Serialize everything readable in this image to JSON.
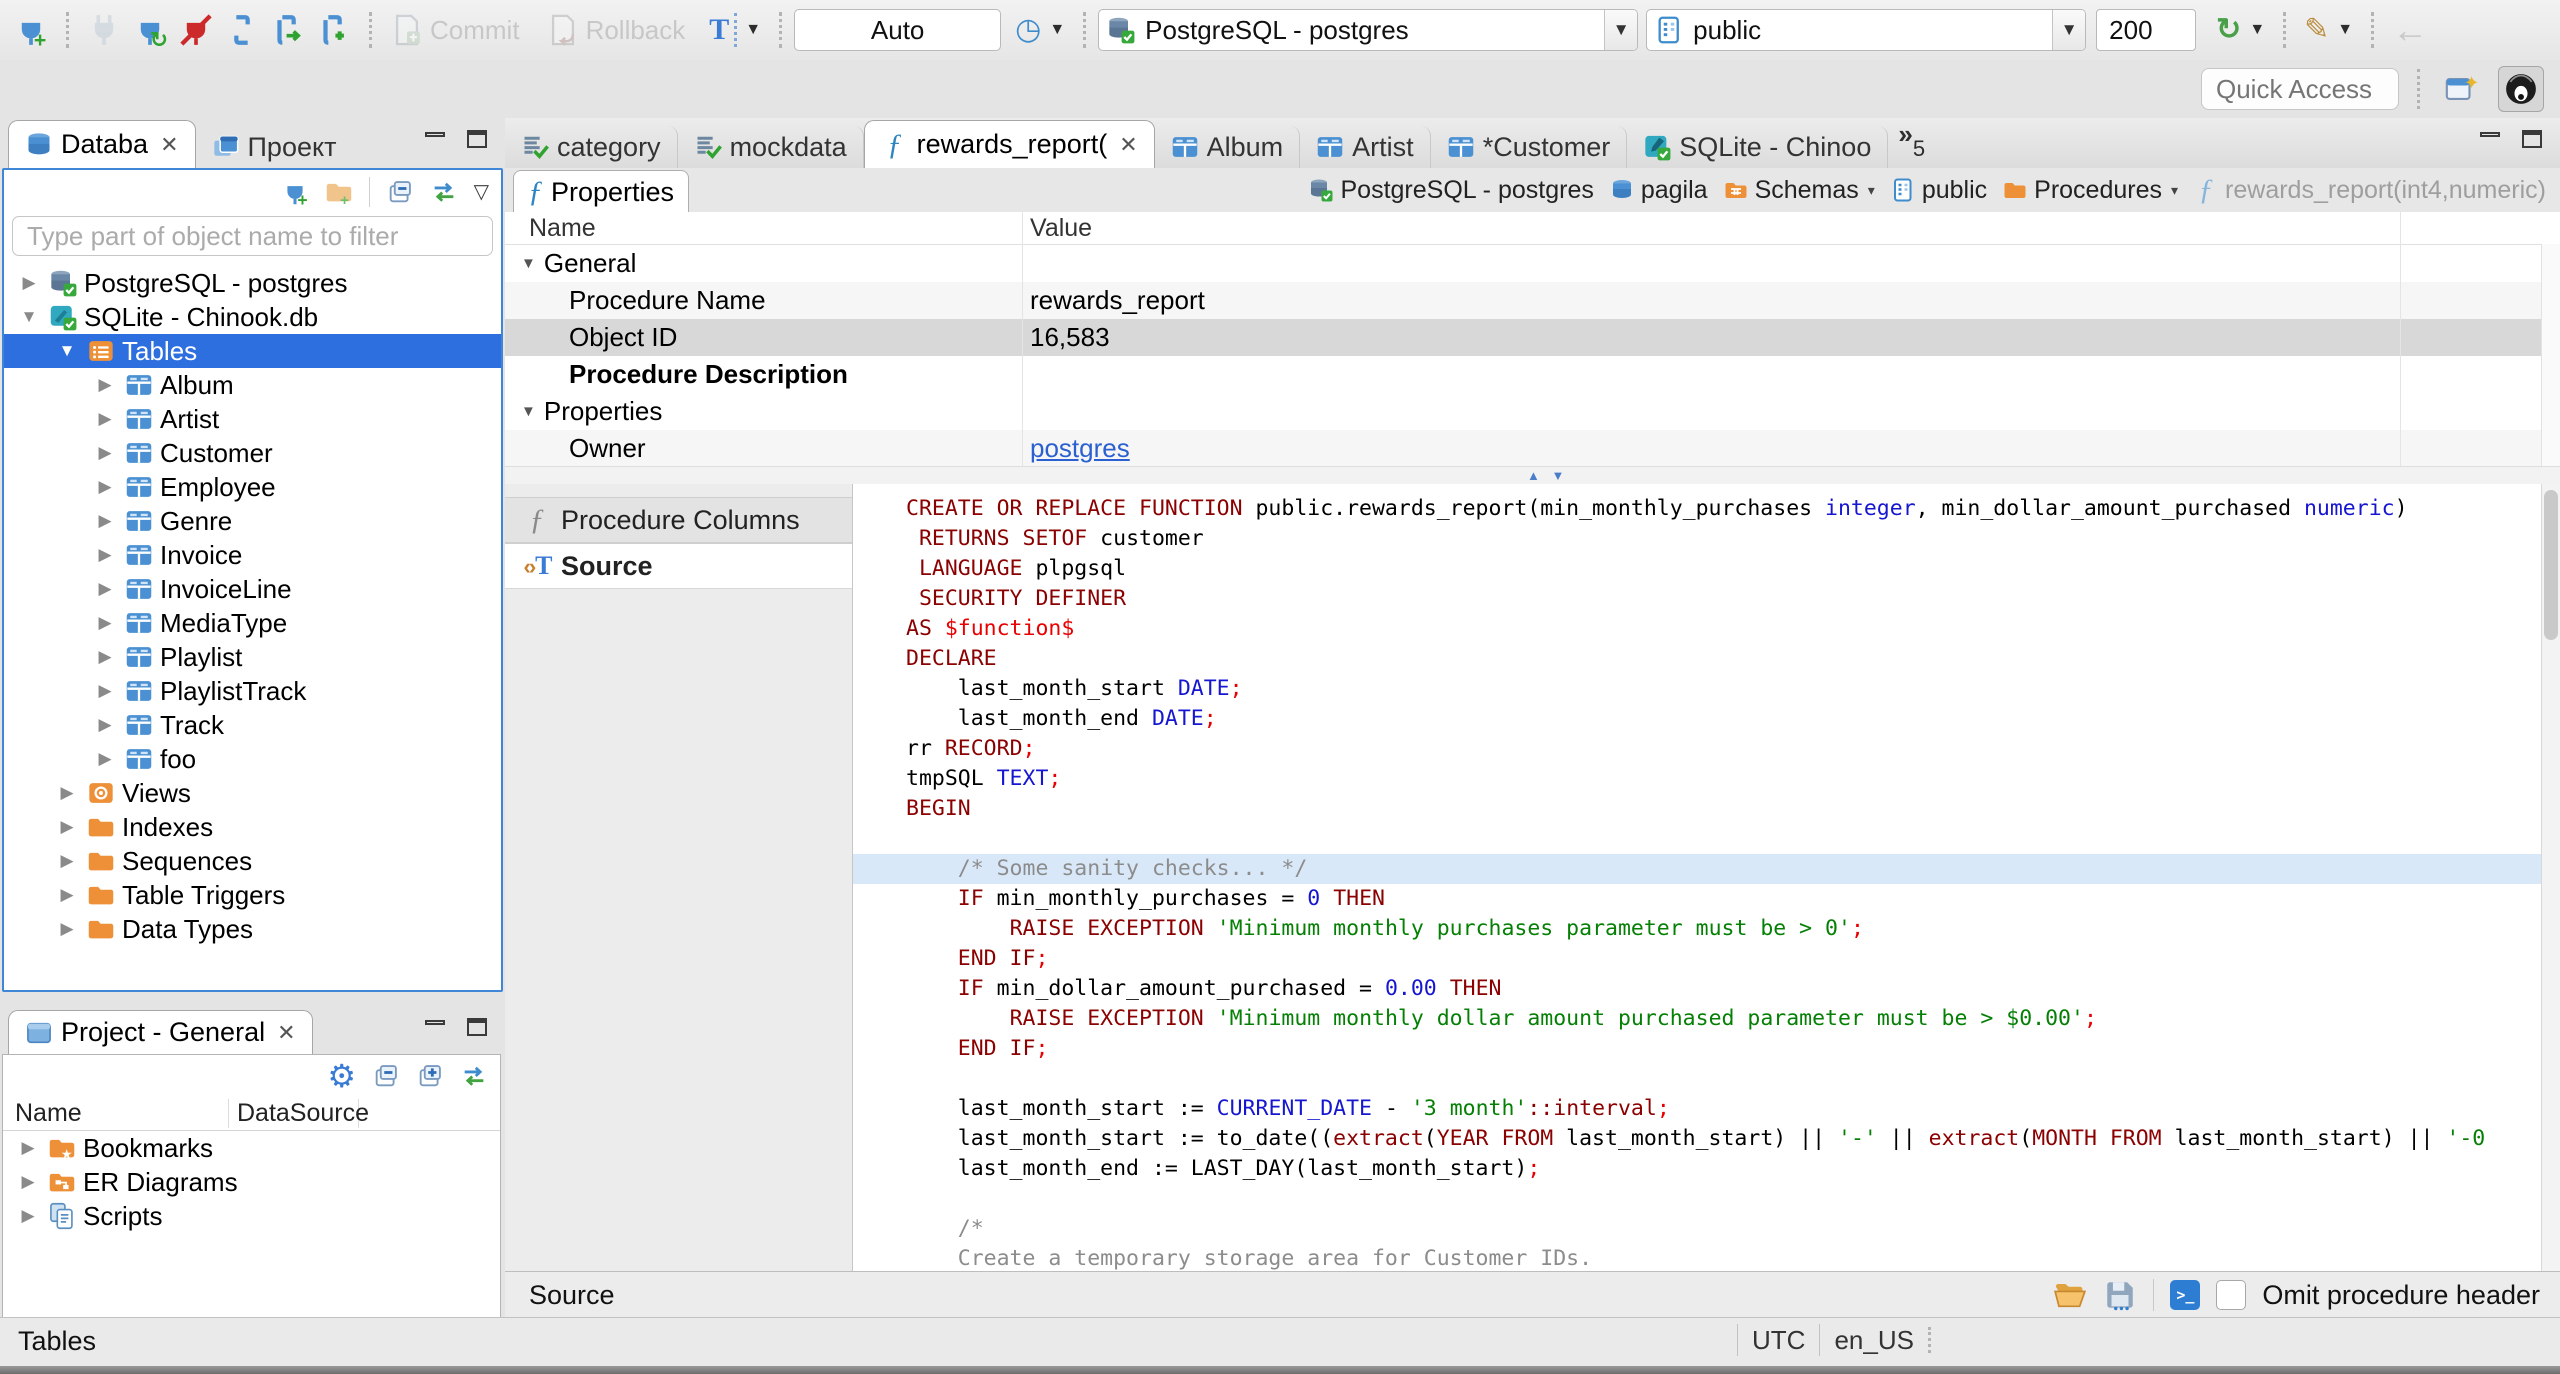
{
  "window": {
    "quick_access_placeholder": "Quick Access"
  },
  "toolbar": {
    "commit_label": "Commit",
    "rollback_label": "Rollback",
    "auto_label": "Auto",
    "connection_value": "PostgreSQL - postgres",
    "schema_value": "public",
    "fetch_size_value": "200"
  },
  "sidebar": {
    "nav_tab_label": "Databa",
    "project_tab_label": "Проект",
    "filter_placeholder": "Type part of object name to filter",
    "tree_items": [
      {
        "label": "PostgreSQL - postgres",
        "icon": "db-pg",
        "lvl": 0,
        "exp": "c"
      },
      {
        "label": "SQLite - Chinook.db",
        "icon": "db-sqlite",
        "lvl": 0,
        "exp": "e"
      },
      {
        "label": "Tables",
        "icon": "folder-tables",
        "lvl": 1,
        "exp": "e",
        "sel": true
      },
      {
        "label": "Album",
        "icon": "table",
        "lvl": 2,
        "exp": "c"
      },
      {
        "label": "Artist",
        "icon": "table",
        "lvl": 2,
        "exp": "c"
      },
      {
        "label": "Customer",
        "icon": "table",
        "lvl": 2,
        "exp": "c"
      },
      {
        "label": "Employee",
        "icon": "table",
        "lvl": 2,
        "exp": "c"
      },
      {
        "label": "Genre",
        "icon": "table",
        "lvl": 2,
        "exp": "c"
      },
      {
        "label": "Invoice",
        "icon": "table",
        "lvl": 2,
        "exp": "c"
      },
      {
        "label": "InvoiceLine",
        "icon": "table",
        "lvl": 2,
        "exp": "c"
      },
      {
        "label": "MediaType",
        "icon": "table",
        "lvl": 2,
        "exp": "c"
      },
      {
        "label": "Playlist",
        "icon": "table",
        "lvl": 2,
        "exp": "c"
      },
      {
        "label": "PlaylistTrack",
        "icon": "table",
        "lvl": 2,
        "exp": "c"
      },
      {
        "label": "Track",
        "icon": "table",
        "lvl": 2,
        "exp": "c"
      },
      {
        "label": "foo",
        "icon": "table",
        "lvl": 2,
        "exp": "c"
      },
      {
        "label": "Views",
        "icon": "folder-views",
        "lvl": 1,
        "exp": "c"
      },
      {
        "label": "Indexes",
        "icon": "folder",
        "lvl": 1,
        "exp": "c"
      },
      {
        "label": "Sequences",
        "icon": "folder",
        "lvl": 1,
        "exp": "c"
      },
      {
        "label": "Table Triggers",
        "icon": "folder",
        "lvl": 1,
        "exp": "c"
      },
      {
        "label": "Data Types",
        "icon": "folder",
        "lvl": 1,
        "exp": "c"
      }
    ]
  },
  "project_panel": {
    "title": "Project - General",
    "columns": [
      "Name",
      "DataSource"
    ],
    "items": [
      {
        "label": "Bookmarks",
        "icon": "folder-bm"
      },
      {
        "label": "ER Diagrams",
        "icon": "folder-er"
      },
      {
        "label": "Scripts",
        "icon": "scripts"
      }
    ]
  },
  "editor": {
    "tabs": [
      {
        "label": "category",
        "icon": "sql-file"
      },
      {
        "label": "mockdata",
        "icon": "sql-file"
      },
      {
        "label": "rewards_report(",
        "icon": "fn",
        "active": true,
        "close": true
      },
      {
        "label": "Album",
        "icon": "table"
      },
      {
        "label": "Artist",
        "icon": "table"
      },
      {
        "label": "*Customer",
        "icon": "table"
      },
      {
        "label": "SQLite - Chinoo",
        "icon": "sqlite-file"
      }
    ],
    "overflow_count": "5",
    "properties_tab_label": "Properties",
    "breadcrumb": [
      {
        "label": "PostgreSQL - postgres",
        "icon": "db-pg"
      },
      {
        "label": "pagila",
        "icon": "db-blue"
      },
      {
        "label": "Schemas",
        "icon": "folder-schemas",
        "caret": true
      },
      {
        "label": "public",
        "icon": "schema-page"
      },
      {
        "label": "Procedures",
        "icon": "folder",
        "caret": true
      },
      {
        "label": "rewards_report(int4,numeric)",
        "icon": "fn-lite",
        "muted": true
      }
    ],
    "properties_columns": [
      "Name",
      "Value"
    ],
    "properties_rows": [
      {
        "group": true,
        "name": "General"
      },
      {
        "name": "Procedure Name",
        "value": "rewards_report",
        "shade": true
      },
      {
        "name": "Object ID",
        "value": "16,583",
        "selected": true
      },
      {
        "name": "Procedure Description",
        "bold": true
      },
      {
        "group": true,
        "name": "Properties"
      },
      {
        "name": "Owner",
        "value": "postgres",
        "link": true,
        "shade": true
      }
    ],
    "subtabs": [
      {
        "label": "Procedure Columns",
        "icon": "fn-gray"
      },
      {
        "label": "Source",
        "icon": "source-tag",
        "active": true
      }
    ],
    "status_label": "Source",
    "omit_checkbox_label": "Omit procedure header"
  },
  "code": {
    "lines": [
      {
        "t": [
          [
            "k",
            "CREATE OR REPLACE FUNCTION"
          ],
          [
            "p",
            " public.rewards_report(min_monthly_purchases "
          ],
          [
            "t",
            "integer"
          ],
          [
            "p",
            ", min_dollar_amount_purchased "
          ],
          [
            "t",
            "numeric"
          ],
          [
            "p",
            ")"
          ]
        ]
      },
      {
        "t": [
          [
            "p",
            " "
          ],
          [
            "k",
            "RETURNS SETOF"
          ],
          [
            "p",
            " customer"
          ]
        ]
      },
      {
        "t": [
          [
            "p",
            " "
          ],
          [
            "k",
            "LANGUAGE"
          ],
          [
            "p",
            " plpgsql"
          ]
        ]
      },
      {
        "t": [
          [
            "p",
            " "
          ],
          [
            "k",
            "SECURITY DEFINER"
          ]
        ]
      },
      {
        "t": [
          [
            "k",
            "AS"
          ],
          [
            "r",
            " $function$"
          ]
        ]
      },
      {
        "t": [
          [
            "k",
            "DECLARE"
          ]
        ]
      },
      {
        "t": [
          [
            "p",
            "    last_month_start "
          ],
          [
            "t",
            "DATE"
          ],
          [
            "r",
            ";"
          ]
        ]
      },
      {
        "t": [
          [
            "p",
            "    last_month_end "
          ],
          [
            "t",
            "DATE"
          ],
          [
            "r",
            ";"
          ]
        ]
      },
      {
        "t": [
          [
            "p",
            "rr "
          ],
          [
            "k",
            "RECORD"
          ],
          [
            "r",
            ";"
          ]
        ]
      },
      {
        "t": [
          [
            "p",
            "tmpSQL "
          ],
          [
            "t",
            "TEXT"
          ],
          [
            "r",
            ";"
          ]
        ]
      },
      {
        "t": [
          [
            "k",
            "BEGIN"
          ]
        ]
      },
      {
        "t": []
      },
      {
        "hl": true,
        "t": [
          [
            "c",
            "    /* Some sanity checks... */"
          ]
        ]
      },
      {
        "t": [
          [
            "p",
            "    "
          ],
          [
            "k",
            "IF"
          ],
          [
            "p",
            " min_monthly_purchases = "
          ],
          [
            "t",
            "0"
          ],
          [
            "p",
            " "
          ],
          [
            "k",
            "THEN"
          ]
        ]
      },
      {
        "t": [
          [
            "p",
            "        "
          ],
          [
            "k",
            "RAISE EXCEPTION"
          ],
          [
            "p",
            " "
          ],
          [
            "s",
            "'Minimum monthly purchases parameter must be > 0'"
          ],
          [
            "r",
            ";"
          ]
        ]
      },
      {
        "t": [
          [
            "p",
            "    "
          ],
          [
            "k",
            "END IF"
          ],
          [
            "r",
            ";"
          ]
        ]
      },
      {
        "t": [
          [
            "p",
            "    "
          ],
          [
            "k",
            "IF"
          ],
          [
            "p",
            " min_dollar_amount_purchased = "
          ],
          [
            "t",
            "0.00"
          ],
          [
            "p",
            " "
          ],
          [
            "k",
            "THEN"
          ]
        ]
      },
      {
        "t": [
          [
            "p",
            "        "
          ],
          [
            "k",
            "RAISE EXCEPTION"
          ],
          [
            "p",
            " "
          ],
          [
            "s",
            "'Minimum monthly dollar amount purchased parameter must be > $0.00'"
          ],
          [
            "r",
            ";"
          ]
        ]
      },
      {
        "t": [
          [
            "p",
            "    "
          ],
          [
            "k",
            "END IF"
          ],
          [
            "r",
            ";"
          ]
        ]
      },
      {
        "t": []
      },
      {
        "t": [
          [
            "p",
            "    last_month_start := "
          ],
          [
            "t",
            "CURRENT_DATE"
          ],
          [
            "p",
            " - "
          ],
          [
            "s",
            "'3 month'"
          ],
          [
            "k",
            "::interval"
          ],
          [
            "r",
            ";"
          ]
        ]
      },
      {
        "t": [
          [
            "p",
            "    last_month_start := to_date(("
          ],
          [
            "k",
            "extract"
          ],
          [
            "p",
            "("
          ],
          [
            "k",
            "YEAR FROM"
          ],
          [
            "p",
            " last_month_start) || "
          ],
          [
            "s",
            "'-'"
          ],
          [
            "p",
            " || "
          ],
          [
            "k",
            "extract"
          ],
          [
            "p",
            "("
          ],
          [
            "k",
            "MONTH FROM"
          ],
          [
            "p",
            " last_month_start) || "
          ],
          [
            "s",
            "'-0"
          ]
        ]
      },
      {
        "t": [
          [
            "p",
            "    last_month_end := LAST_DAY(last_month_start)"
          ],
          [
            "r",
            ";"
          ]
        ]
      },
      {
        "t": []
      },
      {
        "t": [
          [
            "c",
            "    /*"
          ]
        ]
      },
      {
        "t": [
          [
            "c",
            "    Create a temporary storage area for Customer IDs."
          ]
        ]
      },
      {
        "t": [
          [
            "c",
            "    */"
          ]
        ]
      }
    ]
  },
  "statusbar": {
    "left": "Tables",
    "timezone": "UTC",
    "locale": "en_US"
  },
  "colors": {
    "selection_blue": "#2e6fe0",
    "focus_border": "#3f87d6",
    "link_blue": "#2a60d0",
    "keyword": "#8b0000",
    "datatype": "#1616d1",
    "string": "#058005",
    "punct_red": "#e80000",
    "comment": "#8c8c8c",
    "line_highlight": "#d9e8f8",
    "folder_orange": "#ed9038",
    "table_blue": "#4a90d2"
  }
}
